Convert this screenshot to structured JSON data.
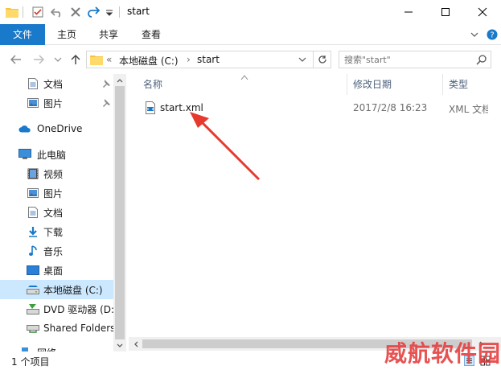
{
  "window": {
    "title": "start"
  },
  "ribbon": {
    "tabs": [
      "文件",
      "主页",
      "共享",
      "查看"
    ]
  },
  "address": {
    "overflow": "«",
    "crumbs": [
      "本地磁盘 (C:)",
      "start"
    ]
  },
  "search": {
    "placeholder": "搜索\"start\""
  },
  "nav_pane": {
    "items": [
      {
        "label": "文档",
        "icon": "document-icon",
        "pinned": true
      },
      {
        "label": "图片",
        "icon": "picture-icon",
        "pinned": true
      },
      {
        "label": "OneDrive",
        "icon": "onedrive-cloud-icon"
      },
      {
        "label": "此电脑",
        "icon": "this-pc-icon"
      },
      {
        "label": "视频",
        "icon": "video-icon"
      },
      {
        "label": "图片",
        "icon": "picture-icon"
      },
      {
        "label": "文档",
        "icon": "document-icon"
      },
      {
        "label": "下载",
        "icon": "download-icon"
      },
      {
        "label": "音乐",
        "icon": "music-icon"
      },
      {
        "label": "桌面",
        "icon": "desktop-icon"
      },
      {
        "label": "本地磁盘 (C:)",
        "icon": "local-disk-icon",
        "selected": true
      },
      {
        "label": "DVD 驱动器 (D:",
        "icon": "dvd-drive-icon"
      },
      {
        "label": "Shared Folders",
        "icon": "shared-folders-icon"
      },
      {
        "label": "网络",
        "icon": "network-icon"
      }
    ]
  },
  "columns": {
    "name": "名称",
    "date": "修改日期",
    "type": "类型"
  },
  "files": [
    {
      "name": "start.xml",
      "date": "2017/2/8 16:23",
      "type": "XML 文档",
      "icon": "xml-file-icon"
    }
  ],
  "status": {
    "count_text": "1 个项目"
  },
  "watermark": "威航软件园",
  "colors": {
    "accent": "#1979ca",
    "selection": "#cce8ff",
    "annotation": "#e8392f"
  }
}
